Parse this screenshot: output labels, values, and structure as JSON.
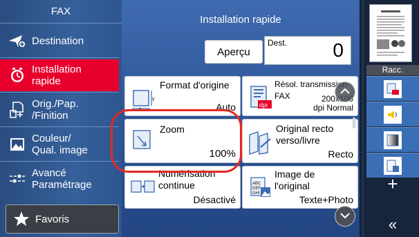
{
  "sidebar": {
    "title": "FAX",
    "items": [
      {
        "label": "Destination",
        "icon": "destination-icon"
      },
      {
        "label": "Installation\nrapide",
        "icon": "quick-setup-icon"
      },
      {
        "label": "Orig./Pap.\n/Finition",
        "icon": "original-paper-icon"
      },
      {
        "label": "Couleur/\nQual. image",
        "icon": "color-quality-icon"
      },
      {
        "label": "Avancé\nParamétrage",
        "icon": "advanced-settings-icon"
      }
    ],
    "favorites_label": "Favoris"
  },
  "main": {
    "title": "Installation rapide",
    "preview_label": "Aperçu",
    "dest_label": "Dest.",
    "dest_count": "0",
    "tiles": [
      {
        "title": "Format d'origine",
        "value": "Auto"
      },
      {
        "title": "Résol. transmission\nFAX",
        "value": "200x100\ndpi Normal"
      },
      {
        "title": "Zoom",
        "value": "100%"
      },
      {
        "title": "Original recto\nverso/livre",
        "value": "Recto"
      },
      {
        "title": "Numérisation\ncontinue",
        "value": "Désactivé"
      },
      {
        "title": "Image de\nl'original",
        "value": "Texte+Photo"
      }
    ]
  },
  "right": {
    "shortcuts_label": "Racc.",
    "plus": "+",
    "collapse": "«"
  },
  "colors": {
    "active": "#e8002d",
    "highlight_ring": "#e8271f",
    "accent_blue": "#3a6fb5"
  }
}
